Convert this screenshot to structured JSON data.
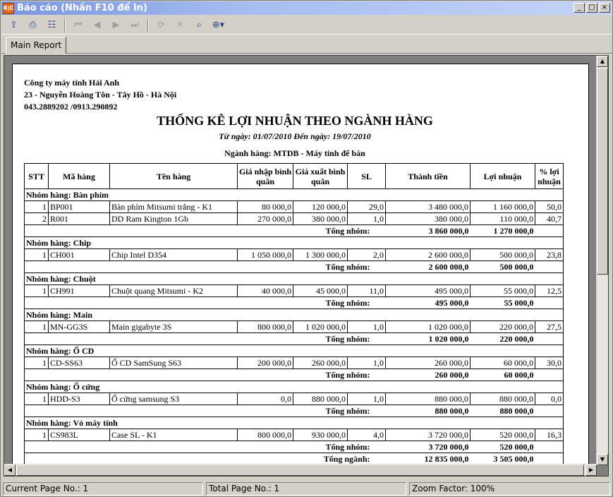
{
  "window": {
    "app_icon_text": "R|C",
    "title": "Báo cáo (Nhấn F10 để In)",
    "btn_min": "_",
    "btn_max": "□",
    "btn_close": "×"
  },
  "toolbar": {
    "export_icon": "⇪",
    "print_icon": "⎙",
    "tree_icon": "☷",
    "first_icon": "⏮",
    "prev_icon": "◀",
    "next_icon": "▶",
    "last_icon": "⏭",
    "refresh_icon": "⟳",
    "stop_icon": "✕",
    "find_icon": "⌕",
    "zoom_icon": "⊕▾"
  },
  "tab": {
    "label": "Main Report"
  },
  "report": {
    "company_name": "Công ty máy tính Hải Anh",
    "company_address": "23 - Nguyễn Hoàng Tôn - Tây Hồ - Hà Nội",
    "company_phone": "043.2889202 /0913.290892",
    "title": "THỐNG KÊ LỢI NHUẬN THEO NGÀNH HÀNG",
    "date_range": "Từ ngày: 01/07/2010 Đến ngày: 19/07/2010",
    "category": "Ngành hàng: MTDB - Máy tính để bàn",
    "headers": {
      "stt": "STT",
      "code": "Mã hàng",
      "name": "Tên hàng",
      "avg_in": "Giá  nhập bình quân",
      "avg_out": "Giá xuất bình quân",
      "qty": "SL",
      "amount": "Thành tiền",
      "profit": "Lợi nhuận",
      "pct": "% lợi nhuận"
    },
    "group_total_label": "Tổng nhóm:",
    "grand_total_label": "Tổng ngành:",
    "grand_total_amount": "12 835 000,0",
    "grand_total_profit": "3 505 000,0",
    "groups": [
      {
        "name": "Nhóm hàng: Bàn phím",
        "rows": [
          {
            "stt": "1",
            "code": "BP001",
            "name": "Bàn phím Mitsumi trắng - K1",
            "avg_in": "80 000,0",
            "avg_out": "120 000,0",
            "qty": "29,0",
            "amount": "3 480 000,0",
            "profit": "1 160 000,0",
            "pct": "50,0"
          },
          {
            "stt": "2",
            "code": "R001",
            "name": "DD Ram Kington 1Gb",
            "avg_in": "270 000,0",
            "avg_out": "380 000,0",
            "qty": "1,0",
            "amount": "380 000,0",
            "profit": "110 000,0",
            "pct": "40,7"
          }
        ],
        "total_amount": "3 860 000,0",
        "total_profit": "1 270 000,0"
      },
      {
        "name": "Nhóm hàng: Chip",
        "rows": [
          {
            "stt": "1",
            "code": "CH001",
            "name": "Chip Intel D354",
            "avg_in": "1 050 000,0",
            "avg_out": "1 300 000,0",
            "qty": "2,0",
            "amount": "2 600 000,0",
            "profit": "500 000,0",
            "pct": "23,8"
          }
        ],
        "total_amount": "2 600 000,0",
        "total_profit": "500 000,0"
      },
      {
        "name": "Nhóm hàng: Chuột",
        "rows": [
          {
            "stt": "1",
            "code": "CH991",
            "name": "Chuột quang Mitsumi - K2",
            "avg_in": "40 000,0",
            "avg_out": "45 000,0",
            "qty": "11,0",
            "amount": "495 000,0",
            "profit": "55 000,0",
            "pct": "12,5"
          }
        ],
        "total_amount": "495 000,0",
        "total_profit": "55 000,0"
      },
      {
        "name": "Nhóm hàng: Main",
        "rows": [
          {
            "stt": "1",
            "code": "MN-GG3S",
            "name": "Main gigabyte 3S",
            "avg_in": "800 000,0",
            "avg_out": "1 020 000,0",
            "qty": "1,0",
            "amount": "1 020 000,0",
            "profit": "220 000,0",
            "pct": "27,5"
          }
        ],
        "total_amount": "1 020 000,0",
        "total_profit": "220 000,0"
      },
      {
        "name": "Nhóm hàng: Ổ CD",
        "rows": [
          {
            "stt": "1",
            "code": "CD-SS63",
            "name": "Ổ CD SamSung S63",
            "avg_in": "200 000,0",
            "avg_out": "260 000,0",
            "qty": "1,0",
            "amount": "260 000,0",
            "profit": "60 000,0",
            "pct": "30,0"
          }
        ],
        "total_amount": "260 000,0",
        "total_profit": "60 000,0"
      },
      {
        "name": "Nhóm hàng: Ổ cứng",
        "rows": [
          {
            "stt": "1",
            "code": "HDD-S3",
            "name": "Ổ cứng samsung S3",
            "avg_in": "0,0",
            "avg_out": "880 000,0",
            "qty": "1,0",
            "amount": "880 000,0",
            "profit": "880 000,0",
            "pct": "0,0"
          }
        ],
        "total_amount": "880 000,0",
        "total_profit": "880 000,0"
      },
      {
        "name": "Nhóm hàng: Vỏ máy tính",
        "rows": [
          {
            "stt": "1",
            "code": "CS983L",
            "name": "Case SL - K1",
            "avg_in": "800 000,0",
            "avg_out": "930 000,0",
            "qty": "4,0",
            "amount": "3 720 000,0",
            "profit": "520 000,0",
            "pct": "16,3"
          }
        ],
        "total_amount": "3 720 000,0",
        "total_profit": "520 000,0"
      }
    ]
  },
  "scroll": {
    "up": "▲",
    "down": "▼",
    "left": "◀",
    "right": "▶"
  },
  "status": {
    "current_page": "Current Page No.: 1",
    "total_page": "Total Page No.: 1",
    "zoom": "Zoom Factor: 100%"
  }
}
